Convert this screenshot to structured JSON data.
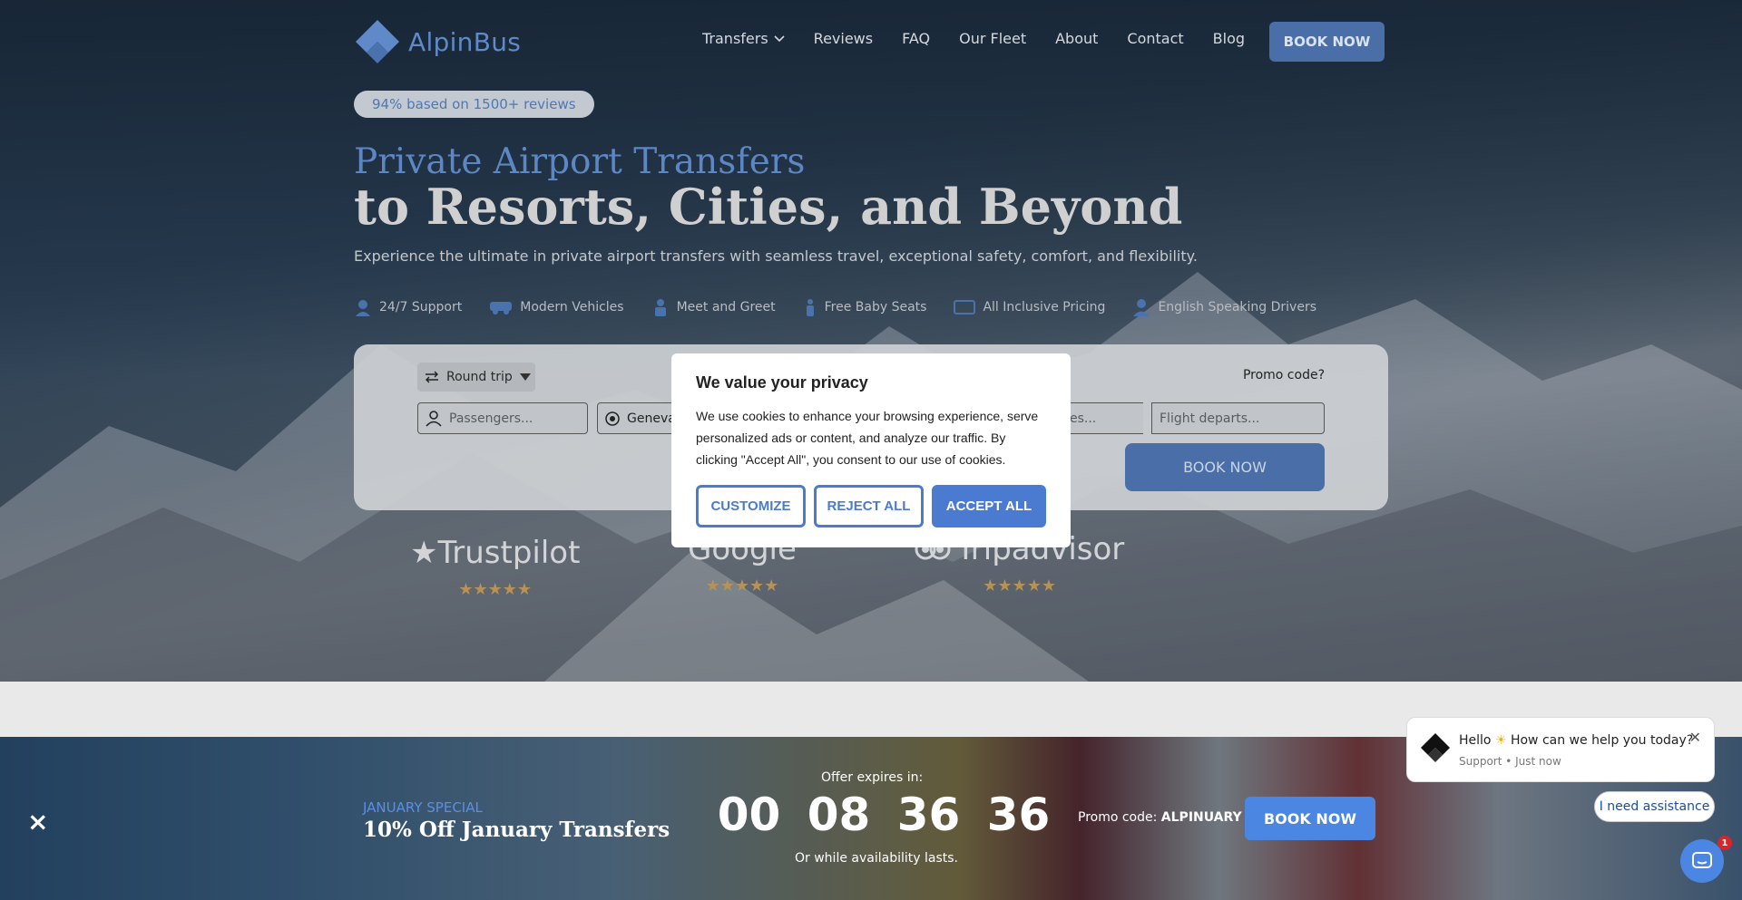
{
  "brand": {
    "name": "AlpinBus",
    "accent": "#4a7bd0"
  },
  "nav": {
    "items": [
      {
        "label": "Transfers"
      },
      {
        "label": "Reviews"
      },
      {
        "label": "FAQ"
      },
      {
        "label": "Our Fleet"
      },
      {
        "label": "About"
      },
      {
        "label": "Contact"
      },
      {
        "label": "Blog"
      }
    ],
    "book_label": "BOOK NOW"
  },
  "hero": {
    "rating_pill": "94% based on 1500+ reviews",
    "title_line1": "Private Airport Transfers",
    "title_line2": "to Resorts, Cities, and Beyond",
    "subtitle": "Experience the ultimate in private airport transfers with seamless travel, exceptional safety, comfort, and flexibility.",
    "features": [
      {
        "label": "24/7 Support",
        "icon": "support-agent-icon"
      },
      {
        "label": "Modern Vehicles",
        "icon": "van-icon"
      },
      {
        "label": "Meet and Greet",
        "icon": "handshake-icon"
      },
      {
        "label": "Free Baby Seats",
        "icon": "baby-seat-icon"
      },
      {
        "label": "All Inclusive Pricing",
        "icon": "price-tag-icon"
      },
      {
        "label": "English Speaking Drivers",
        "icon": "driver-icon"
      }
    ]
  },
  "booking": {
    "trip_type": "Round trip",
    "promo_link": "Promo code?",
    "passengers_placeholder": "Passengers...",
    "from_value": "Geneva",
    "arrives_placeholder": "es...",
    "departs_placeholder": "Flight departs...",
    "book_label": "BOOK NOW"
  },
  "reviews": [
    {
      "name": "Trustpilot",
      "stars": "★★★★★"
    },
    {
      "name": "Google",
      "stars": "★★★★★"
    },
    {
      "name": "Tripadvisor",
      "stars": "★★★★★"
    }
  ],
  "cookie": {
    "title": "We value your privacy",
    "body": "We use cookies to enhance your browsing experience, serve personalized ads or content, and analyze our traffic. By clicking \"Accept All\", you consent to our use of cookies.",
    "customize": "CUSTOMIZE",
    "reject": "REJECT ALL",
    "accept": "ACCEPT ALL"
  },
  "promo_band": {
    "close": "×",
    "kicker": "JANUARY SPECIAL",
    "headline": "10% Off January Transfers",
    "expires_label": "Offer expires in:",
    "timer": [
      "00",
      "08",
      "36",
      "36"
    ],
    "availability": "Or while availability lasts.",
    "promo_prefix": "Promo code:",
    "promo_code": "ALPINUARY",
    "book_label": "BOOK NOW"
  },
  "chat": {
    "message_prefix": "Hello",
    "message_suffix": "How can we help you today?",
    "meta": "Support • Just now",
    "assist": "I need assistance",
    "badge": "1"
  }
}
